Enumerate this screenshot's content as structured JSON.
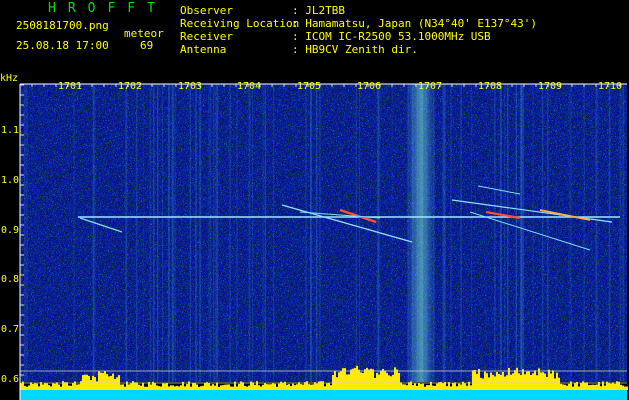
{
  "app_title": "HROFFT",
  "file": {
    "name": "2508181700.png",
    "datetime": "25.08.18 17:00"
  },
  "meteor": {
    "label": "meteor",
    "count": "69"
  },
  "info": [
    {
      "key": "Observer",
      "value": ": JL2TBB"
    },
    {
      "key": "Receiving Location",
      "value": ": Hamamatsu, Japan (N34°40' E137°43')"
    },
    {
      "key": "Receiver",
      "value": ": ICOM IC-R2500 53.1000MHz USB"
    },
    {
      "key": "Antenna",
      "value": ": HB9CV Zenith dir."
    }
  ],
  "spectrogram": {
    "unit": "kHz",
    "time_ticks": [
      "1701",
      "1702",
      "1703",
      "1704",
      "1705",
      "1706",
      "1707",
      "1708",
      "1709",
      "1710"
    ],
    "freq_ticks": [
      "1.1",
      "1.0",
      "0.9",
      "0.8",
      "0.7",
      "0.6"
    ],
    "colors": {
      "background": "#0a1a9a",
      "noise": "#3aa0ff",
      "carrier": "#9fe8ff",
      "echo": "#ff5030",
      "level": "#ffea00",
      "baseline": "#00d8ff"
    }
  }
}
